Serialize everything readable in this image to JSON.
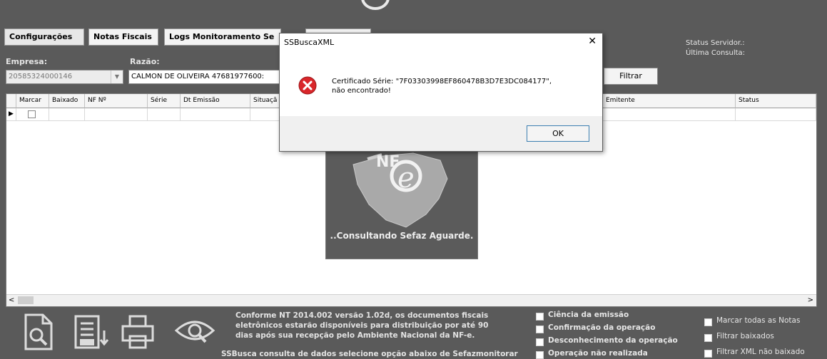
{
  "tabs": [
    {
      "label": "Configurações"
    },
    {
      "label": "Notas Fiscais"
    },
    {
      "label": "Logs Monitoramento Se"
    },
    {
      "label": ""
    }
  ],
  "empresa": {
    "label": "Empresa:",
    "value": "20585324000146"
  },
  "razao": {
    "label": "Razão:",
    "value": "CALMON DE OLIVEIRA 47681977600:"
  },
  "filtrar_label": "Filtrar",
  "status": {
    "servidor": "Status Servidor.:",
    "ultima": "Última Consulta:"
  },
  "grid": {
    "headers": [
      "Marcar",
      "Baixado",
      "NF Nº",
      "Série",
      "Dt Emissão",
      "Situaçã",
      "Emitente",
      "Status"
    ]
  },
  "loading": {
    "text": "..Consultando Sefaz Aguarde."
  },
  "dialog": {
    "title": "SSBuscaXML",
    "close": "✕",
    "message_line1": "Certificado Série: \"7F03303998EF860478B3D7E3DC084177\",",
    "message_line2": "não encontrado!",
    "ok_label": "OK"
  },
  "scroll": {
    "left": "<",
    "right": ">"
  },
  "footer": {
    "nt_lines": [
      "Conforme NT 2014.002 versão 1.02d, os documentos fiscais",
      "eletrônicos estarão disponíveis para distribuição por até 90",
      "dias após sua recepção pelo Ambiente Nacional da NF-e."
    ],
    "partial": "SSBusca consulta de dados selecione opção abaixo de Sefazmonitorar",
    "events": [
      "Ciência da emissão",
      "Confirmação da operação",
      "Desconhecimento da operação",
      "Operação não realizada"
    ],
    "right_opts": [
      "Marcar todas as Notas",
      "Filtrar baixados",
      "Filtrar XML não baixado"
    ],
    "icons": [
      "document-search-icon",
      "xml-download-icon",
      "printer-icon",
      "view-eye-icon"
    ]
  }
}
